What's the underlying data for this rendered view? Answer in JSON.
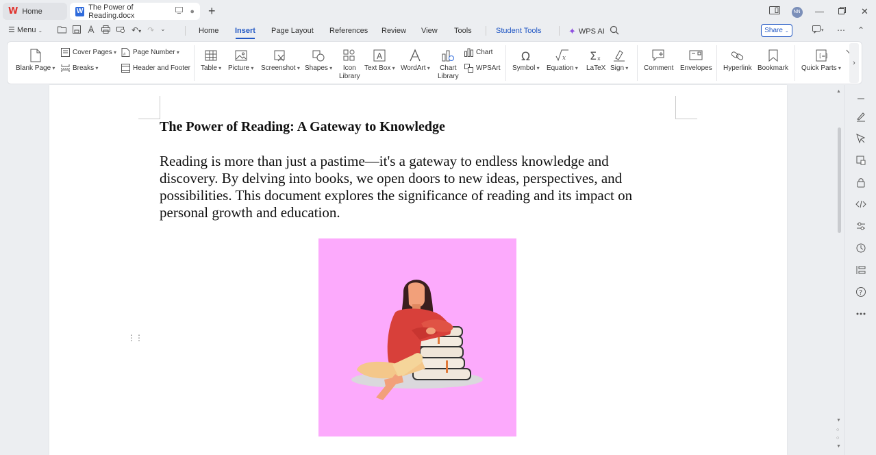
{
  "tabs": {
    "home_label": "Home",
    "doc_label": "The Power of Reading.docx",
    "new_tab_symbol": "+"
  },
  "menu": {
    "menu_label": "Menu",
    "tabs": [
      "Home",
      "Insert",
      "Page Layout",
      "References",
      "Review",
      "View",
      "Tools",
      "Student Tools"
    ],
    "active_tab": "Insert",
    "wps_ai_label": "WPS AI",
    "share_label": "Share"
  },
  "ribbon": {
    "blank_page": "Blank Page",
    "cover_pages": "Cover Pages",
    "breaks": "Breaks",
    "page_number": "Page Number",
    "header_footer": "Header and Footer",
    "table": "Table",
    "picture": "Picture",
    "screenshot": "Screenshot",
    "shapes": "Shapes",
    "icon_library_1": "Icon",
    "icon_library_2": "Library",
    "text_box": "Text Box",
    "wordart": "WordArt",
    "chart_library_1": "Chart",
    "chart_library_2": "Library",
    "chart": "Chart",
    "wpsart": "WPSArt",
    "symbol": "Symbol",
    "equation": "Equation",
    "latex": "LaTeX",
    "sign": "Sign",
    "comment": "Comment",
    "envelopes": "Envelopes",
    "hyperlink": "Hyperlink",
    "bookmark": "Bookmark",
    "quick_parts": "Quick Parts"
  },
  "document": {
    "title": "The Power of Reading: A Gateway to Knowledge",
    "paragraph": "Reading is more than just a pastime—it's a gateway to endless knowledge and discovery. By delving into books, we open doors to new ideas, perspectives, and possibilities. This document explores the significance of reading and its impact on personal growth and education.",
    "image_background": "#fcaafc"
  },
  "colors": {
    "accent": "#2157c4",
    "wps_red": "#e0322d",
    "ai_purple": "#8e4fe0"
  }
}
